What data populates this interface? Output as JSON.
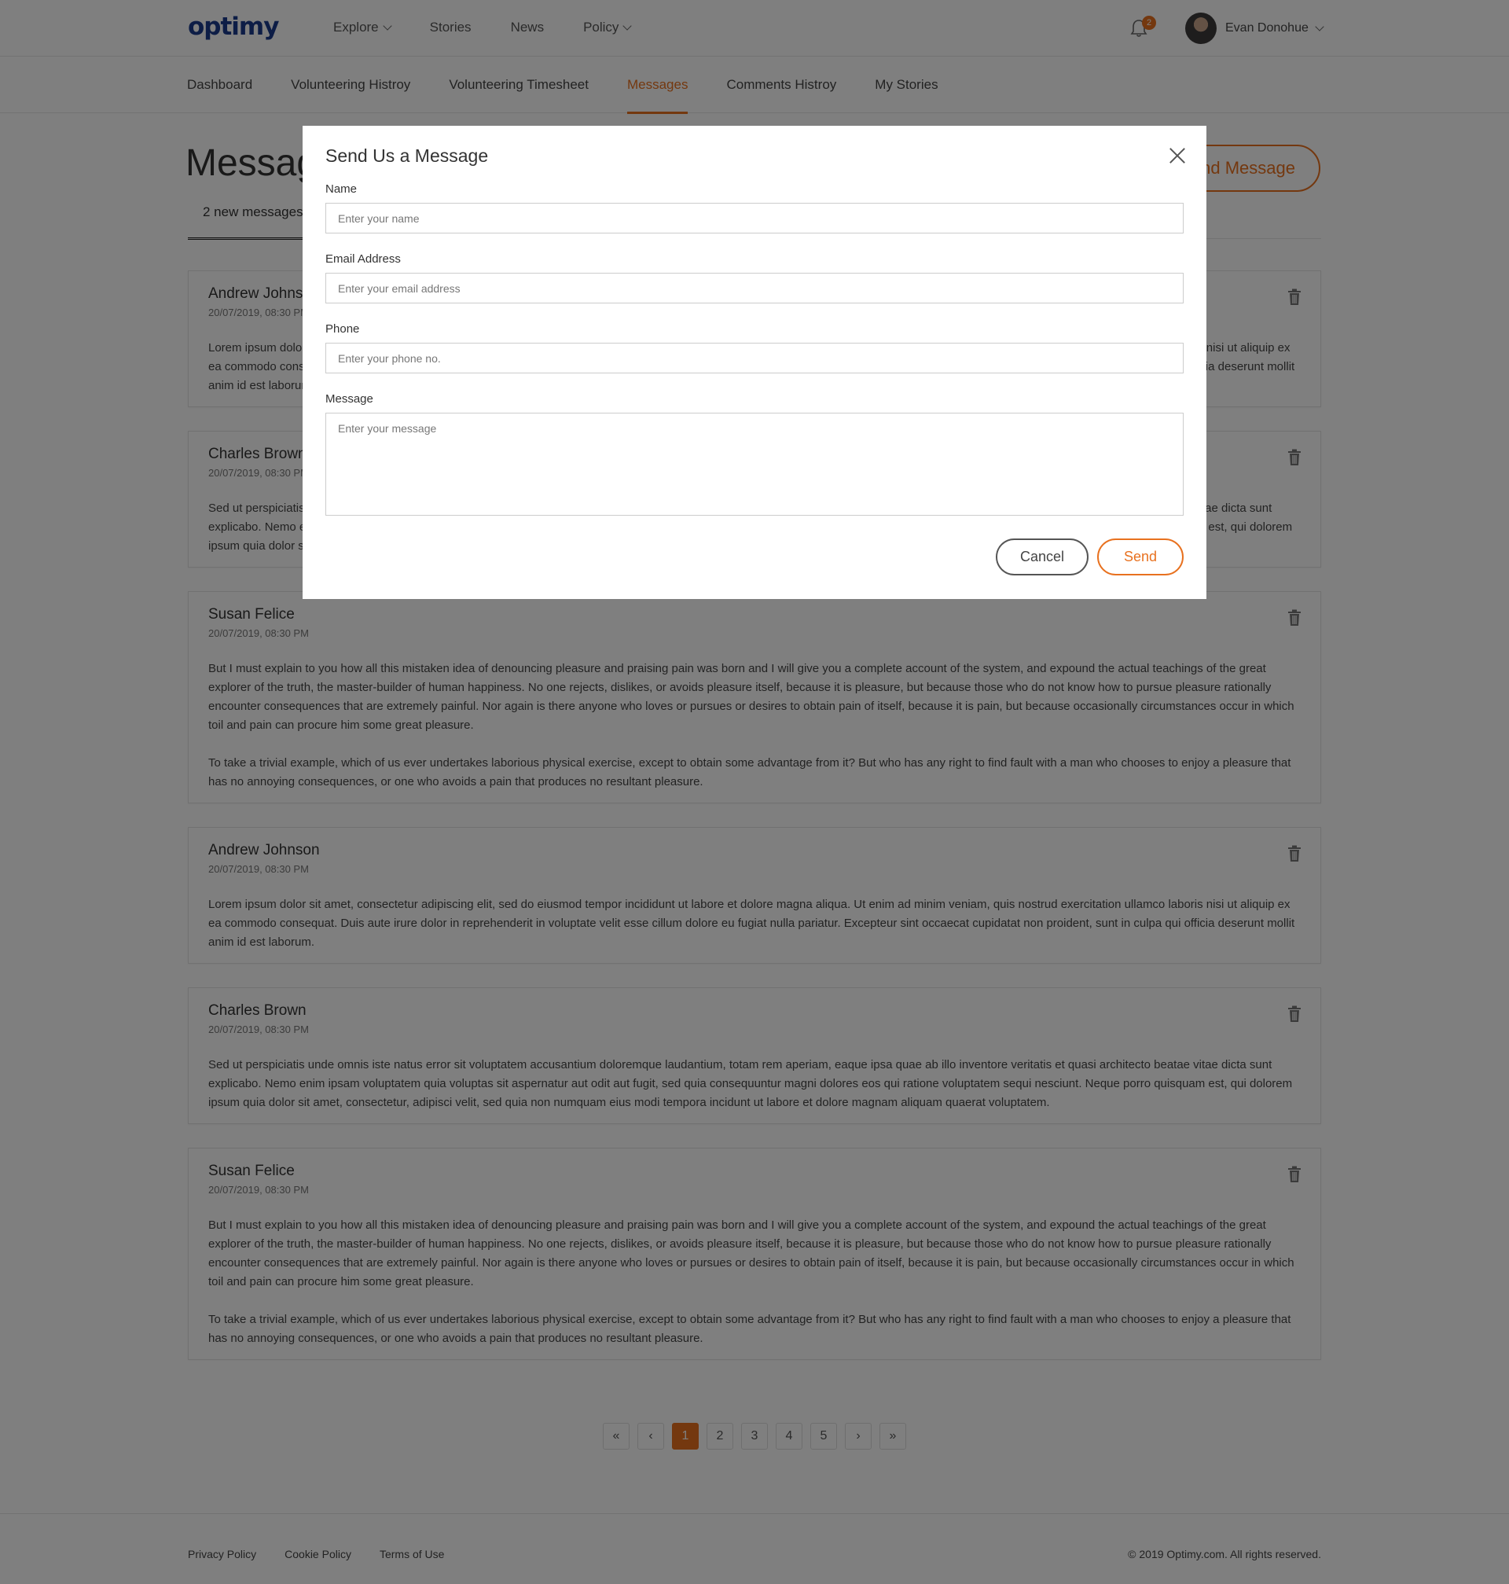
{
  "header": {
    "logo": "optimy",
    "nav": [
      {
        "label": "Explore",
        "dropdown": true
      },
      {
        "label": "Stories",
        "dropdown": false
      },
      {
        "label": "News",
        "dropdown": false
      },
      {
        "label": "Policy",
        "dropdown": true
      }
    ],
    "notification_count": "2",
    "user_name": "Evan Donohue"
  },
  "subnav": {
    "tabs": [
      "Dashboard",
      "Volunteering Histroy",
      "Volunteering Timesheet",
      "Messages",
      "Comments Histroy",
      "My Stories"
    ],
    "active": "Messages"
  },
  "page": {
    "title": "Messages",
    "send_button": "Send Message",
    "filter_tab": "2 new messages"
  },
  "messages": [
    {
      "author": "Andrew Johnson",
      "date": "20/07/2019, 08:30 PM",
      "paragraphs": [
        "Lorem ipsum dolor sit amet, consectetur adipiscing elit, sed do eiusmod tempor incididunt ut labore et dolore magna aliqua. Ut enim ad minim veniam, quis nostrud exercitation ullamco laboris nisi ut aliquip ex ea commodo consequat. Duis aute irure dolor in reprehenderit in voluptate velit esse cillum dolore eu fugiat nulla pariatur. Excepteur sint occaecat cupidatat non proident, sunt in culpa qui officia deserunt mollit anim id est laborum."
      ]
    },
    {
      "author": "Charles Brown",
      "date": "20/07/2019, 08:30 PM",
      "paragraphs": [
        "Sed ut perspiciatis unde omnis iste natus error sit voluptatem accusantium doloremque laudantium, totam rem aperiam, eaque ipsa quae ab illo inventore veritatis et quasi architecto beatae vitae dicta sunt explicabo. Nemo enim ipsam voluptatem quia voluptas sit aspernatur aut odit aut fugit, sed quia consequuntur magni dolores eos qui ratione voluptatem sequi nesciunt. Neque porro quisquam est, qui dolorem ipsum quia dolor sit amet, consectetur, adipisci velit, sed quia non numquam eius modi tempora incidunt ut labore et dolore magnam aliquam quaerat voluptatem."
      ]
    },
    {
      "author": "Susan Felice",
      "date": "20/07/2019, 08:30 PM",
      "paragraphs": [
        "But I must explain to you how all this mistaken idea of denouncing pleasure and praising pain was born and I will give you a complete account of the system, and expound the actual teachings of the great explorer of the truth, the master-builder of human happiness. No one rejects, dislikes, or avoids pleasure itself, because it is pleasure, but because those who do not know how to pursue pleasure rationally encounter consequences that are extremely painful. Nor again is there anyone who loves or pursues or desires to obtain pain of itself, because it is pain, but because occasionally circumstances occur in which toil and pain can procure him some great pleasure.",
        "To take a trivial example, which of us ever undertakes laborious physical exercise, except to obtain some advantage from it? But who has any right to find fault with a man who chooses to enjoy a pleasure that has no annoying consequences, or one who avoids a pain that produces no resultant pleasure."
      ]
    },
    {
      "author": "Andrew Johnson",
      "date": "20/07/2019, 08:30 PM",
      "paragraphs": [
        "Lorem ipsum dolor sit amet, consectetur adipiscing elit, sed do eiusmod tempor incididunt ut labore et dolore magna aliqua. Ut enim ad minim veniam, quis nostrud exercitation ullamco laboris nisi ut aliquip ex ea commodo consequat. Duis aute irure dolor in reprehenderit in voluptate velit esse cillum dolore eu fugiat nulla pariatur. Excepteur sint occaecat cupidatat non proident, sunt in culpa qui officia deserunt mollit anim id est laborum."
      ]
    },
    {
      "author": "Charles Brown",
      "date": "20/07/2019, 08:30 PM",
      "paragraphs": [
        "Sed ut perspiciatis unde omnis iste natus error sit voluptatem accusantium doloremque laudantium, totam rem aperiam, eaque ipsa quae ab illo inventore veritatis et quasi architecto beatae vitae dicta sunt explicabo. Nemo enim ipsam voluptatem quia voluptas sit aspernatur aut odit aut fugit, sed quia consequuntur magni dolores eos qui ratione voluptatem sequi nesciunt. Neque porro quisquam est, qui dolorem ipsum quia dolor sit amet, consectetur, adipisci velit, sed quia non numquam eius modi tempora incidunt ut labore et dolore magnam aliquam quaerat voluptatem."
      ]
    },
    {
      "author": "Susan Felice",
      "date": "20/07/2019, 08:30 PM",
      "paragraphs": [
        "But I must explain to you how all this mistaken idea of denouncing pleasure and praising pain was born and I will give you a complete account of the system, and expound the actual teachings of the great explorer of the truth, the master-builder of human happiness. No one rejects, dislikes, or avoids pleasure itself, because it is pleasure, but because those who do not know how to pursue pleasure rationally encounter consequences that are extremely painful. Nor again is there anyone who loves or pursues or desires to obtain pain of itself, because it is pain, but because occasionally circumstances occur in which toil and pain can procure him some great pleasure.",
        "To take a trivial example, which of us ever undertakes laborious physical exercise, except to obtain some advantage from it? But who has any right to find fault with a man who chooses to enjoy a pleasure that has no annoying consequences, or one who avoids a pain that produces no resultant pleasure."
      ]
    }
  ],
  "pagination": {
    "first": "«",
    "prev": "‹",
    "pages": [
      "1",
      "2",
      "3",
      "4",
      "5"
    ],
    "current": "1",
    "next": "›",
    "last": "»"
  },
  "footer": {
    "links": [
      "Privacy Policy",
      "Cookie Policy",
      "Terms of Use"
    ],
    "copyright": "© 2019 Optimy.com. All rights reserved."
  },
  "modal": {
    "title": "Send Us a Message",
    "fields": {
      "name": {
        "label": "Name",
        "placeholder": "Enter your name",
        "value": ""
      },
      "email": {
        "label": "Email Address",
        "placeholder": "Enter your email address",
        "value": ""
      },
      "phone": {
        "label": "Phone",
        "placeholder": "Enter your phone no.",
        "value": ""
      },
      "message": {
        "label": "Message",
        "placeholder": "Enter your message",
        "value": ""
      }
    },
    "cancel_label": "Cancel",
    "send_label": "Send"
  },
  "colors": {
    "accent": "#e8711f",
    "brand": "#1b3a8c",
    "overlay": "rgba(0,0,0,0.5)"
  },
  "icons": [
    "chevron-down-icon",
    "bell-icon",
    "trash-icon",
    "close-icon"
  ]
}
